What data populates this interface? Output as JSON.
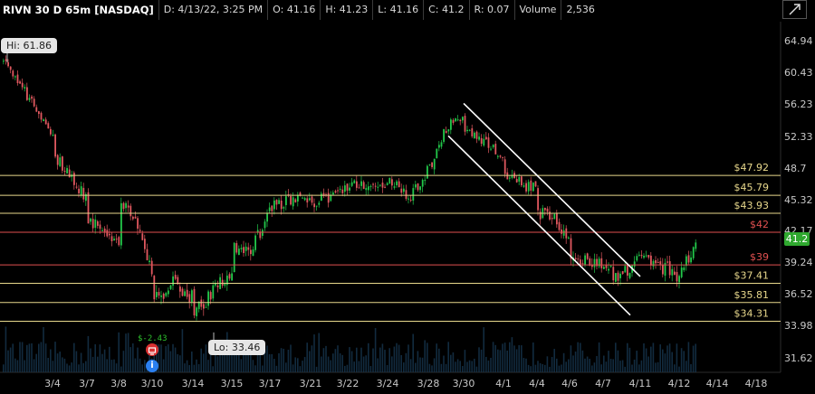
{
  "header": {
    "symbol": "RIVN 30 D 65m [NASDAQ]",
    "date": "D: 4/13/22, 3:25 PM",
    "open": "O: 41.16",
    "high": "H: 41.23",
    "low": "L: 41.16",
    "close": "C: 41.2",
    "range": "R: 0.07",
    "volume_label": "Volume",
    "volume_value": "2,536"
  },
  "icons": {
    "expand": "expand-diagonal-icon",
    "earnings": "earnings-icon",
    "info": "info-icon"
  },
  "annotations": {
    "hi_label": "Hi: 61.86",
    "lo_label": "Lo: 33.46",
    "dividend_text": "$-2.43",
    "info_glyph": "i"
  },
  "current_price": "41.2",
  "colors": {
    "up": "#22c84a",
    "down": "#e0585f",
    "level": "#e8d88c",
    "red_level": "#e05050",
    "channel": "#ffffff"
  },
  "chart_data": {
    "type": "candlestick",
    "ylim": [
      30.5,
      66
    ],
    "y_ticks": [
      "64.94",
      "60.43",
      "56.23",
      "52.33",
      "48.7",
      "45.32",
      "42.17",
      "39.24",
      "36.52",
      "33.98",
      "31.62"
    ],
    "x_ticks": [
      "3/4",
      "3/7",
      "3/8",
      "3/10",
      "3/14",
      "3/15",
      "3/17",
      "3/21",
      "3/22",
      "3/24",
      "3/28",
      "3/30",
      "4/1",
      "4/4",
      "4/6",
      "4/7",
      "4/11",
      "4/12",
      "4/14",
      "4/18"
    ],
    "levels": [
      {
        "label": "$47.92",
        "value": 47.92,
        "color": "#e8d88c"
      },
      {
        "label": "$45.79",
        "value": 45.79,
        "color": "#e8d88c"
      },
      {
        "label": "$43.93",
        "value": 43.93,
        "color": "#e8d88c"
      },
      {
        "label": "$42",
        "value": 42.0,
        "color": "#e05050"
      },
      {
        "label": "$39",
        "value": 39.0,
        "color": "#e05050"
      },
      {
        "label": "$37.41",
        "value": 37.41,
        "color": "#e8d88c"
      },
      {
        "label": "$35.81",
        "value": 35.81,
        "color": "#e8d88c"
      },
      {
        "label": "$34.31",
        "value": 34.31,
        "color": "#e8d88c"
      }
    ],
    "channel_upper": {
      "x": [
        "3/30",
        "4/11"
      ],
      "y": [
        56.3,
        38.0
      ]
    },
    "channel_lower": {
      "x": [
        "3/29",
        "4/7"
      ],
      "y": [
        52.4,
        34.8
      ]
    },
    "close_path": {
      "x": [
        "3/3",
        "3/4",
        "3/4",
        "3/7",
        "3/7",
        "3/8",
        "3/8",
        "3/9",
        "3/10",
        "3/10",
        "3/11",
        "3/14",
        "3/14",
        "3/15",
        "3/15",
        "3/16",
        "3/17",
        "3/18",
        "3/21",
        "3/22",
        "3/22",
        "3/23",
        "3/24",
        "3/25",
        "3/28",
        "3/29",
        "3/30",
        "3/30",
        "3/31",
        "4/1",
        "4/1",
        "4/4",
        "4/4",
        "4/5",
        "4/6",
        "4/6",
        "4/7",
        "4/7",
        "4/8",
        "4/11",
        "4/11",
        "4/12",
        "4/12",
        "4/13"
      ],
      "y": [
        61.86,
        52.5,
        50.2,
        45.4,
        43.5,
        41.0,
        45.5,
        43.0,
        38.5,
        36.0,
        37.5,
        36.0,
        35.0,
        38.5,
        40.5,
        40.0,
        44.5,
        45.5,
        45.0,
        46.5,
        47.0,
        46.5,
        47.5,
        45.5,
        48.5,
        54.0,
        54.5,
        53.0,
        52.0,
        49.0,
        47.5,
        46.5,
        44.0,
        43.5,
        41.5,
        40.0,
        39.0,
        38.5,
        38.0,
        39.5,
        40.0,
        38.0,
        38.0,
        41.2
      ]
    },
    "price_hi": 61.86,
    "price_lo": 33.46,
    "last": 41.2
  }
}
